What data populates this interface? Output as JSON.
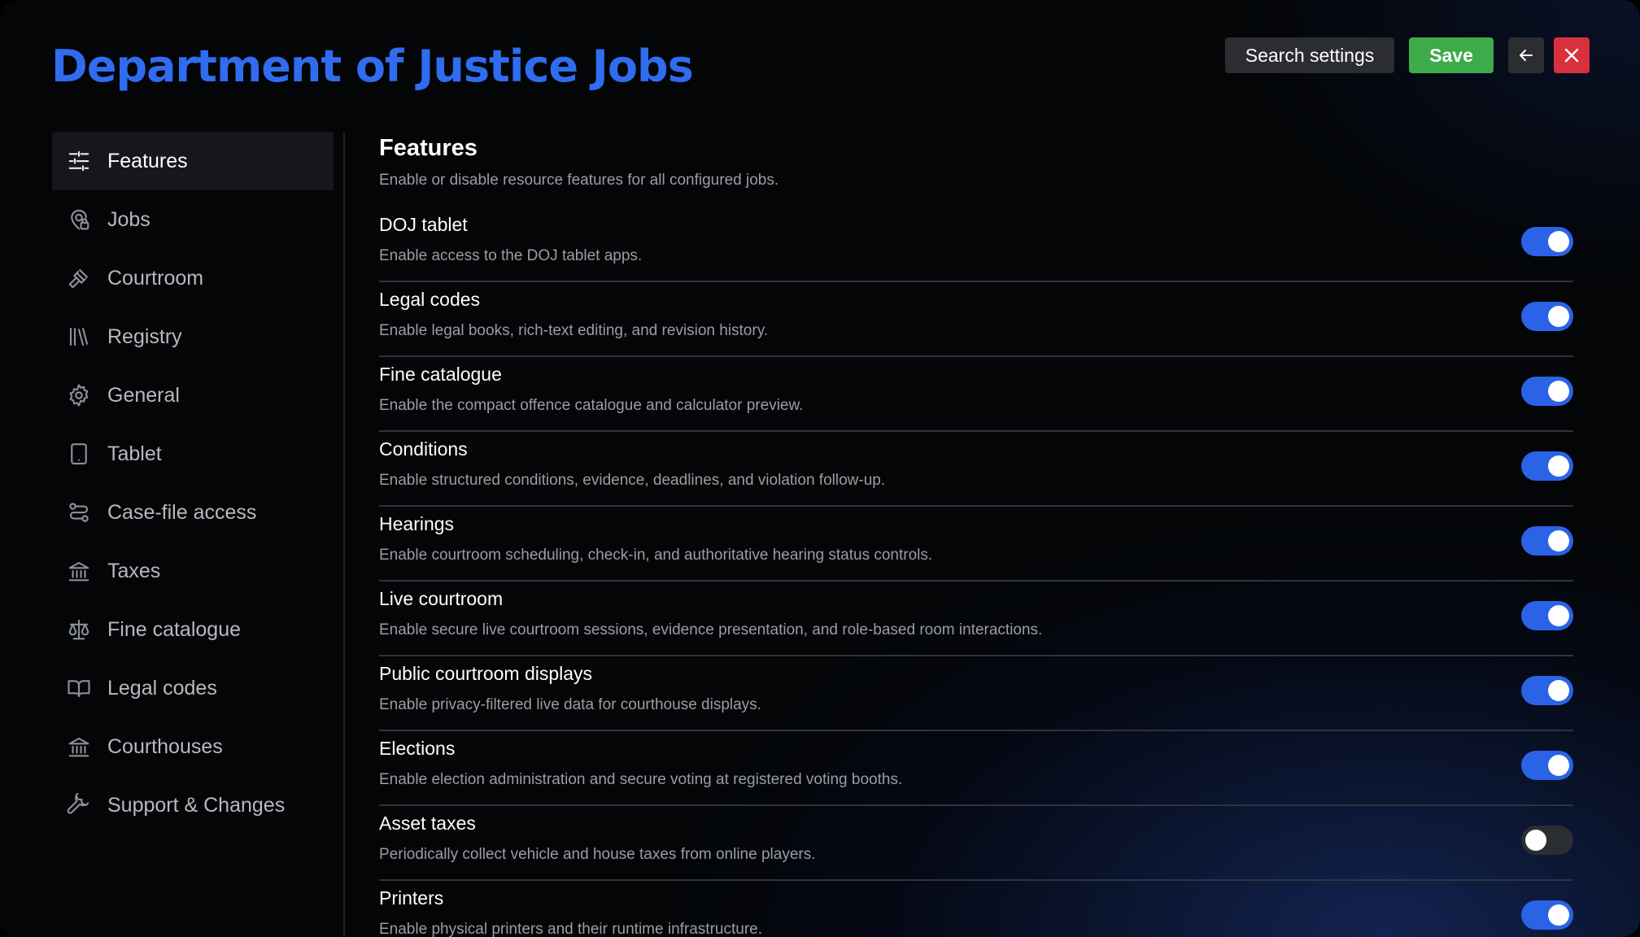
{
  "header": {
    "title": "Department of Justice Jobs",
    "search_label": "Search settings",
    "save_label": "Save"
  },
  "sidebar": {
    "items": [
      {
        "label": "Features",
        "icon": "sliders-icon",
        "active": true
      },
      {
        "label": "Jobs",
        "icon": "user-pin-icon"
      },
      {
        "label": "Courtroom",
        "icon": "gavel-icon"
      },
      {
        "label": "Registry",
        "icon": "books-icon"
      },
      {
        "label": "General",
        "icon": "gear-icon"
      },
      {
        "label": "Tablet",
        "icon": "tablet-icon"
      },
      {
        "label": "Case-file access",
        "icon": "route-icon"
      },
      {
        "label": "Taxes",
        "icon": "bank-icon"
      },
      {
        "label": "Fine catalogue",
        "icon": "scale-icon"
      },
      {
        "label": "Legal codes",
        "icon": "book-open-icon"
      },
      {
        "label": "Courthouses",
        "icon": "courthouse-icon"
      },
      {
        "label": "Support & Changes",
        "icon": "wrench-icon"
      }
    ]
  },
  "main": {
    "title": "Features",
    "description": "Enable or disable resource features for all configured jobs.",
    "features": [
      {
        "title": "DOJ tablet",
        "description": "Enable access to the DOJ tablet apps.",
        "enabled": true
      },
      {
        "title": "Legal codes",
        "description": "Enable legal books, rich-text editing, and revision history.",
        "enabled": true
      },
      {
        "title": "Fine catalogue",
        "description": "Enable the compact offence catalogue and calculator preview.",
        "enabled": true
      },
      {
        "title": "Conditions",
        "description": "Enable structured conditions, evidence, deadlines, and violation follow-up.",
        "enabled": true
      },
      {
        "title": "Hearings",
        "description": "Enable courtroom scheduling, check-in, and authoritative hearing status controls.",
        "enabled": true
      },
      {
        "title": "Live courtroom",
        "description": "Enable secure live courtroom sessions, evidence presentation, and role-based room interactions.",
        "enabled": true
      },
      {
        "title": "Public courtroom displays",
        "description": "Enable privacy-filtered live data for courthouse displays.",
        "enabled": true
      },
      {
        "title": "Elections",
        "description": "Enable election administration and secure voting at registered voting booths.",
        "enabled": true
      },
      {
        "title": "Asset taxes",
        "description": "Periodically collect vehicle and house taxes from online players.",
        "enabled": false
      },
      {
        "title": "Printers",
        "description": "Enable physical printers and their runtime infrastructure.",
        "enabled": true
      }
    ]
  },
  "colors": {
    "accent": "#2f6cf0",
    "save": "#3dab4a",
    "close": "#d9303e",
    "toggle_on": "#2a63e6"
  }
}
